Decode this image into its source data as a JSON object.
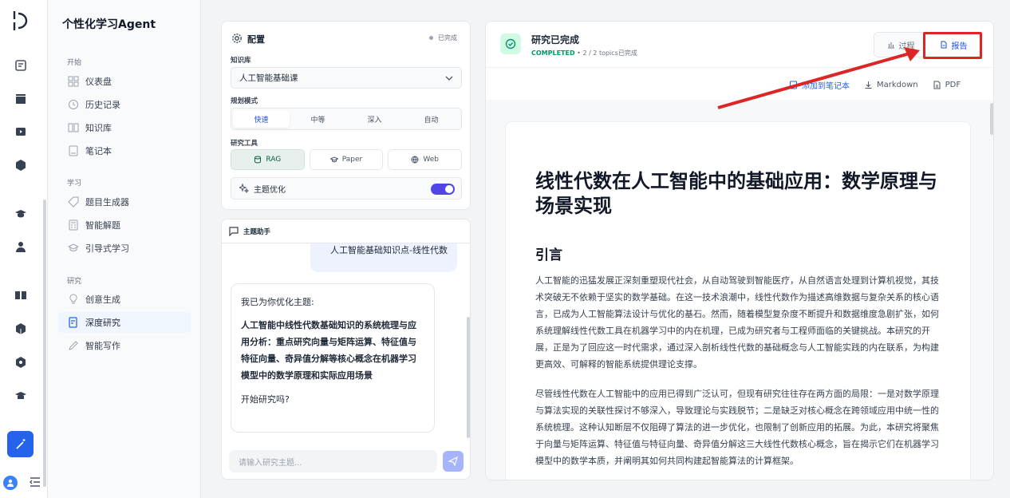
{
  "sidebar": {
    "app_title": "个性化学习Agent",
    "sections": [
      {
        "label": "开始",
        "items": [
          "仪表盘",
          "历史记录",
          "知识库",
          "笔记本"
        ]
      },
      {
        "label": "学习",
        "items": [
          "题目生成器",
          "智能解题",
          "引导式学习"
        ]
      },
      {
        "label": "研究",
        "items": [
          "创意生成",
          "深度研究",
          "智能写作"
        ]
      }
    ],
    "active_item": "深度研究"
  },
  "config": {
    "title": "配置",
    "status": "已完成",
    "kb_label": "知识库",
    "kb_value": "人工智能基础课",
    "mode_label": "规划模式",
    "modes": [
      "快速",
      "中等",
      "深入",
      "自动"
    ],
    "mode_selected": "快速",
    "tools_label": "研究工具",
    "tools": [
      "RAG",
      "Paper",
      "Web"
    ],
    "tool_selected": "RAG",
    "topic_opt_label": "主题优化",
    "topic_opt_on": true
  },
  "assistant": {
    "title": "主题助手",
    "user_message": "人工智能基础知识点-线性代数",
    "bot_intro": "我已为你优化主题:",
    "bot_topic": "人工智能中线性代数基础知识的系统梳理与应用分析：重点研究向量与矩阵运算、特征值与特征向量、奇异值分解等核心概念在机器学习模型中的数学原理和实际应用场景",
    "bot_question": "开始研究吗?",
    "input_placeholder": "请输入研究主题..."
  },
  "report": {
    "status_title": "研究已完成",
    "status_code": "COMPLETED",
    "status_detail": "2 / 2 topics已完成",
    "tab_process": "过程",
    "tab_report": "报告",
    "action_notebook": "添加到笔记本",
    "action_markdown": "Markdown",
    "action_pdf": "PDF",
    "doc_title": "线性代数在人工智能中的基础应用：数学原理与场景实现",
    "intro_heading": "引言",
    "para1": "人工智能的迅猛发展正深刻重塑现代社会，从自动驾驶到智能医疗，从自然语言处理到计算机视觉，其技术突破无不依赖于坚实的数学基础。在这一技术浪潮中，线性代数作为描述高维数据与复杂关系的核心语言，已成为人工智能算法设计与优化的基石。然而，随着模型复杂度不断提升和数据维度急剧扩张，如何系统理解线性代数工具在机器学习中的内在机理，已成为研究者与工程师面临的关键挑战。本研究的开展，正是为了回应这一时代需求，通过深入剖析线性代数的基础概念与人工智能实践的内在联系，为构建更高效、可解释的智能系统提供理论支撑。",
    "para2": "尽管线性代数在人工智能中的应用已得到广泛认可，但现有研究往往存在两方面的局限：一是对数学原理与算法实现的关联性探讨不够深入，导致理论与实践脱节；二是缺乏对核心概念在跨领域应用中统一性的系统梳理。这种认知断层不仅阻碍了算法的进一步优化，也限制了创新应用的拓展。为此，本研究将聚焦于向量与矩阵运算、特征值与特征向量、奇异值分解这三大线性代数核心概念，旨在揭示它们在机器学习模型中的数学本质，并阐明其如何共同构建起智能算法的计算框架。"
  },
  "colors": {
    "accent": "#2563eb",
    "highlight": "#dc2626",
    "success": "#059669",
    "toggle": "#4f46e5"
  }
}
